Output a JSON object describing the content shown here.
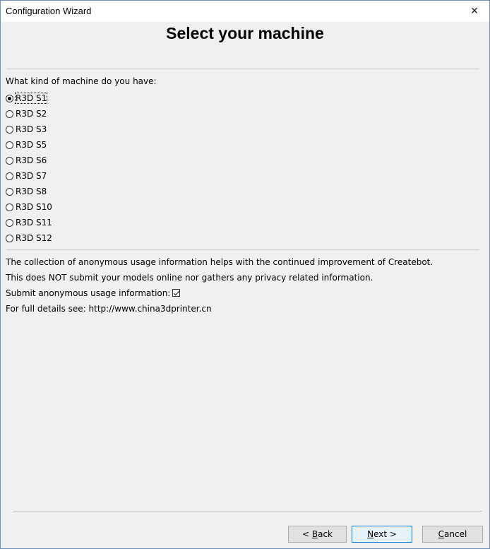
{
  "window": {
    "title": "Configuration Wizard"
  },
  "heading": "Select your machine",
  "question": "What kind of machine do you have:",
  "machines": [
    {
      "label": "R3D S1",
      "selected": true
    },
    {
      "label": "R3D S2",
      "selected": false
    },
    {
      "label": "R3D S3",
      "selected": false
    },
    {
      "label": "R3D S5",
      "selected": false
    },
    {
      "label": "R3D S6",
      "selected": false
    },
    {
      "label": "R3D S7",
      "selected": false
    },
    {
      "label": "R3D S8",
      "selected": false
    },
    {
      "label": "R3D S10",
      "selected": false
    },
    {
      "label": "R3D S11",
      "selected": false
    },
    {
      "label": "R3D S12",
      "selected": false
    }
  ],
  "usage": {
    "line1": "The collection of anonymous usage information helps with the continued improvement of Createbot.",
    "line2": "This does NOT submit your models online nor gathers any privacy related information.",
    "submit_label": "Submit anonymous usage information:",
    "submit_checked": true,
    "details": "For full details see: http://www.china3dprinter.cn"
  },
  "buttons": {
    "back": {
      "prefix": "< ",
      "mnemonic": "B",
      "rest": "ack"
    },
    "next": {
      "mnemonic": "N",
      "rest": "ext >"
    },
    "cancel": {
      "mnemonic": "C",
      "rest": "ancel"
    }
  },
  "colors": {
    "accent": "#0078d7",
    "background": "#f0f0f0"
  }
}
